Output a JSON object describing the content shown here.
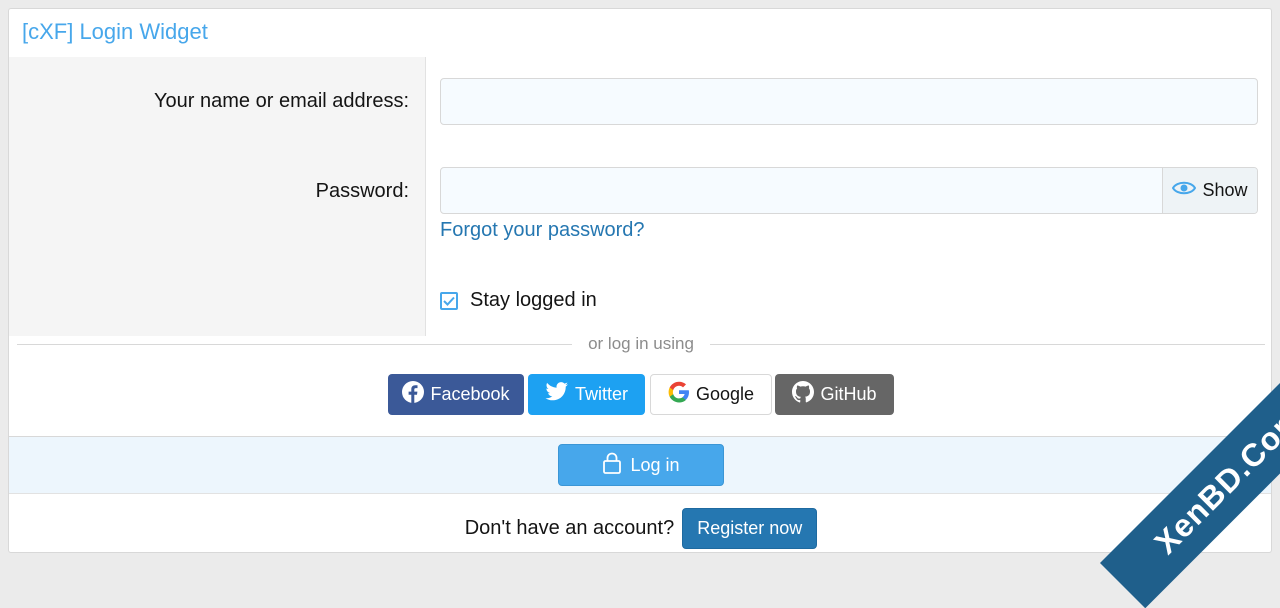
{
  "widget": {
    "title": "[cXF] Login Widget",
    "username_label": "Your name or email address:",
    "username_value": "",
    "password_label": "Password:",
    "password_value": "",
    "show_label": "Show",
    "forgot_link": "Forgot your password?",
    "stay_logged_in": "Stay logged in",
    "stay_logged_in_checked": true
  },
  "social": {
    "divider_text": "or log in using",
    "buttons": [
      {
        "label": "Facebook",
        "icon": "facebook-icon",
        "color": "#3b5998"
      },
      {
        "label": "Twitter",
        "icon": "twitter-icon",
        "color": "#1da1f2"
      },
      {
        "label": "Google",
        "icon": "google-icon",
        "color": "#ffffff"
      },
      {
        "label": "GitHub",
        "icon": "github-icon",
        "color": "#666666"
      }
    ]
  },
  "actions": {
    "login_label": "Log in",
    "no_account_text": "Don't have an account?",
    "register_label": "Register now"
  },
  "watermark": {
    "text": "XenBD.Com"
  },
  "colors": {
    "accent": "#47a7eb",
    "link": "#2577b1",
    "login_bar_bg": "#edf6fd"
  }
}
